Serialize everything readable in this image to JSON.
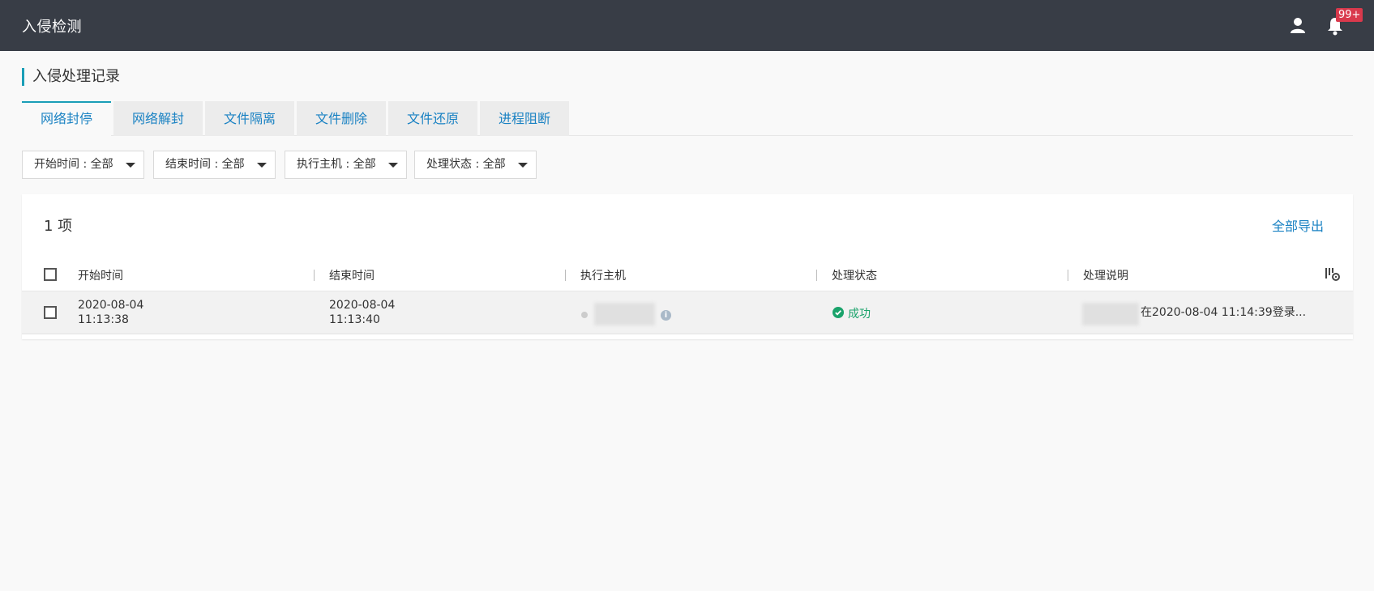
{
  "header": {
    "app_title": "入侵检测",
    "notification_badge": "99+"
  },
  "page": {
    "section_title": "入侵处理记录"
  },
  "tabs": [
    {
      "label": "网络封停",
      "active": true
    },
    {
      "label": "网络解封",
      "active": false
    },
    {
      "label": "文件隔离",
      "active": false
    },
    {
      "label": "文件删除",
      "active": false
    },
    {
      "label": "文件还原",
      "active": false
    },
    {
      "label": "进程阻断",
      "active": false
    }
  ],
  "filters": [
    {
      "label": "开始时间 : 全部"
    },
    {
      "label": "结束时间 : 全部"
    },
    {
      "label": "执行主机 : 全部"
    },
    {
      "label": "处理状态 : 全部"
    }
  ],
  "table": {
    "count_label": "1 项",
    "export_label": "全部导出",
    "columns": [
      "开始时间",
      "结束时间",
      "执行主机",
      "处理状态",
      "处理说明"
    ],
    "rows": [
      {
        "start_date": "2020-08-04",
        "start_time": "11:13:38",
        "end_date": "2020-08-04",
        "end_time": "11:13:40",
        "status": "成功",
        "description": "在2020-08-04 11:14:39登录..."
      }
    ]
  },
  "colors": {
    "topbar": "#383d46",
    "accent": "#1a9eb7",
    "link": "#1a82c3",
    "success": "#1aa36b",
    "badge": "#d9394c"
  }
}
